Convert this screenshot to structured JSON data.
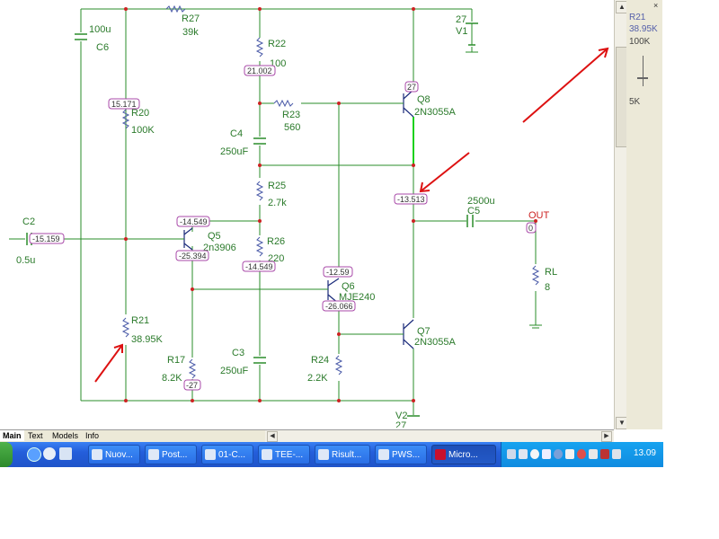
{
  "schematic": {
    "components": {
      "c6": {
        "ref": "C6",
        "value": "100u"
      },
      "r27": {
        "ref": "R27",
        "value": "39k"
      },
      "r22": {
        "ref": "R22",
        "value": "100"
      },
      "v1": {
        "ref": "V1",
        "value": "27"
      },
      "r20": {
        "ref": "R20",
        "value": "100K"
      },
      "r23": {
        "ref": "R23",
        "value": "560"
      },
      "q8": {
        "ref": "Q8",
        "value": "2N3055A"
      },
      "c4": {
        "ref": "C4",
        "value": "250uF"
      },
      "r25": {
        "ref": "R25",
        "value": "2.7k"
      },
      "c5": {
        "ref": "C5",
        "value": "2500u"
      },
      "out": {
        "ref": "OUT"
      },
      "c2": {
        "ref": "C2",
        "value": "0.5u"
      },
      "q5": {
        "ref": "Q5",
        "value": "2n3906"
      },
      "r26": {
        "ref": "R26",
        "value": "220"
      },
      "rl": {
        "ref": "RL",
        "value": "8"
      },
      "q6": {
        "ref": "Q6",
        "value": "MJE240"
      },
      "r21": {
        "ref": "R21",
        "value": "38.95K"
      },
      "q7": {
        "ref": "Q7",
        "value": "2N3055A"
      },
      "r17": {
        "ref": "R17",
        "value": "8.2K"
      },
      "c3": {
        "ref": "C3",
        "value": "250uF"
      },
      "r24": {
        "ref": "R24",
        "value": "2.2K"
      },
      "v2": {
        "ref": "V2",
        "value": "27"
      }
    },
    "node_voltages": {
      "n_r22": "21.002",
      "n_q8c": "27",
      "n_r20": "15.171",
      "n_mid": "-13.513",
      "n_q5b": "-14.549",
      "n_c2": "-15.159",
      "n_out": "0",
      "n_q5c": "-25.394",
      "n_r26b": "-14.549",
      "n_q6b": "-12.59",
      "n_q6e": "-26.066",
      "n_r17": "-27"
    },
    "colors": {
      "wire": "#2a8c2a",
      "junction": "#cc2222",
      "arrow": "#dd1111",
      "label": "#2a7a2a",
      "probe": "#a848a8"
    }
  },
  "slider": {
    "name": "R21",
    "current": "38.95K",
    "max": "100K",
    "min": "5K"
  },
  "tabs": [
    "Main",
    "Text",
    "Models",
    "Info"
  ],
  "taskbar": {
    "buttons": [
      "Nuov...",
      "Post...",
      "01-C...",
      "TEE-...",
      "Risult...",
      "PWS...",
      "Micro..."
    ],
    "clock": "13.09"
  }
}
